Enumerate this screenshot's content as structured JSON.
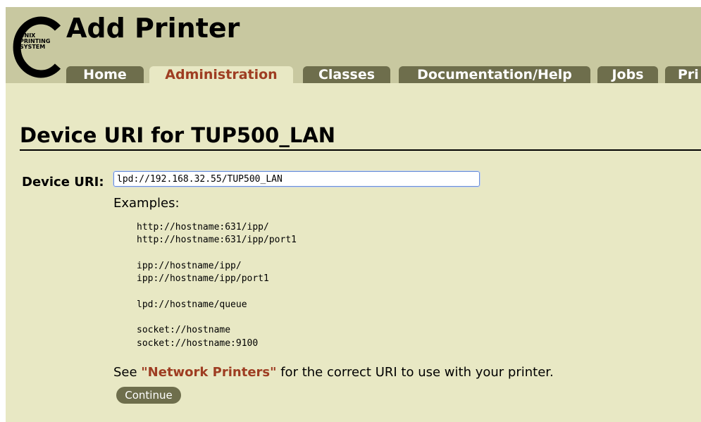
{
  "header": {
    "title": "Add Printer",
    "logo": {
      "line1": "UNIX",
      "line2": "PRINTING",
      "line3": "SYSTEM"
    }
  },
  "tabs": [
    {
      "label": "Home"
    },
    {
      "label": "Administration",
      "active": true
    },
    {
      "label": "Classes"
    },
    {
      "label": "Documentation/Help"
    },
    {
      "label": "Jobs"
    },
    {
      "label": "Pri"
    }
  ],
  "main": {
    "heading": "Device URI for TUP500_LAN",
    "uri_label": "Device URI:",
    "uri_value": "lpd://192.168.32.55/TUP500_LAN",
    "examples_label": "Examples:",
    "examples": [
      [
        "http://hostname:631/ipp/",
        "http://hostname:631/ipp/port1"
      ],
      [
        "ipp://hostname/ipp/",
        "ipp://hostname/ipp/port1"
      ],
      [
        "lpd://hostname/queue"
      ],
      [
        "socket://hostname",
        "socket://hostname:9100"
      ]
    ],
    "see_prefix": "See ",
    "see_link": "\"Network Printers\"",
    "see_suffix": " for the correct URI to use with your printer.",
    "continue_label": "Continue"
  },
  "colors": {
    "page_bg": "#e8e8c4",
    "header_bg": "#c8c8a0",
    "tab_bg": "#6e6e4c",
    "accent": "#9e3d22"
  }
}
